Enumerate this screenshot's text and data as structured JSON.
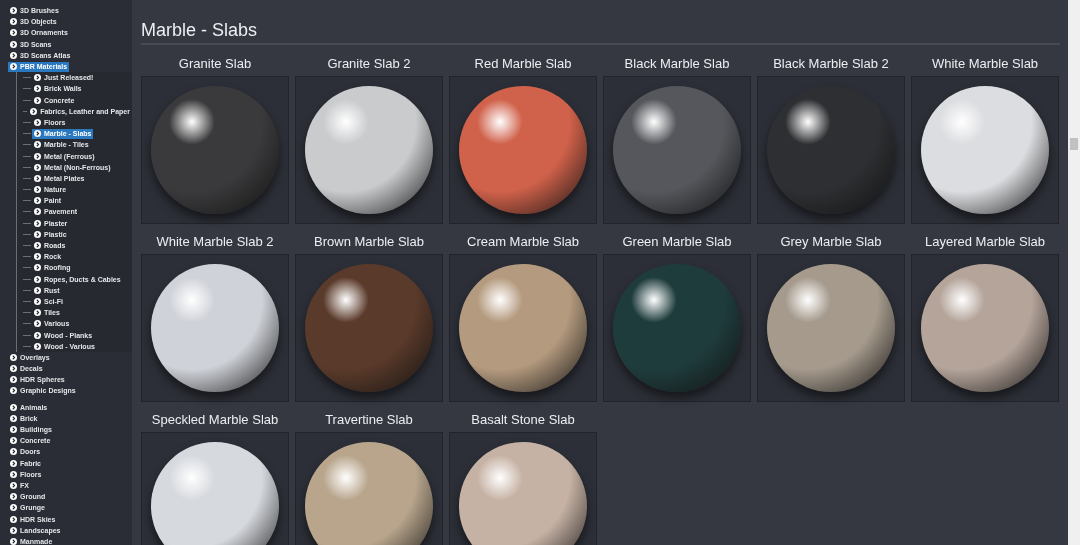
{
  "sidebar": {
    "groups": [
      {
        "items": [
          {
            "label": "3D Brushes",
            "selected": false
          },
          {
            "label": "3D Objects",
            "selected": false
          },
          {
            "label": "3D Ornaments",
            "selected": false
          },
          {
            "label": "3D Scans",
            "selected": false
          },
          {
            "label": "3D Scans Atlas",
            "selected": false
          },
          {
            "label": "PBR Materials",
            "selected": true,
            "children": [
              {
                "label": "Just Released!",
                "selected": false
              },
              {
                "label": "Brick Walls",
                "selected": false
              },
              {
                "label": "Concrete",
                "selected": false
              },
              {
                "label": "Fabrics, Leather and Paper",
                "selected": false
              },
              {
                "label": "Floors",
                "selected": false
              },
              {
                "label": "Marble - Slabs",
                "selected": true
              },
              {
                "label": "Marble - Tiles",
                "selected": false
              },
              {
                "label": "Metal (Ferrous)",
                "selected": false
              },
              {
                "label": "Metal (Non-Ferrous)",
                "selected": false
              },
              {
                "label": "Metal Plates",
                "selected": false
              },
              {
                "label": "Nature",
                "selected": false
              },
              {
                "label": "Paint",
                "selected": false
              },
              {
                "label": "Pavement",
                "selected": false
              },
              {
                "label": "Plaster",
                "selected": false
              },
              {
                "label": "Plastic",
                "selected": false
              },
              {
                "label": "Roads",
                "selected": false
              },
              {
                "label": "Rock",
                "selected": false
              },
              {
                "label": "Roofing",
                "selected": false
              },
              {
                "label": "Ropes, Ducts & Cables",
                "selected": false
              },
              {
                "label": "Rust",
                "selected": false
              },
              {
                "label": "Sci-Fi",
                "selected": false
              },
              {
                "label": "Tiles",
                "selected": false
              },
              {
                "label": "Various",
                "selected": false
              },
              {
                "label": "Wood - Planks",
                "selected": false
              },
              {
                "label": "Wood - Various",
                "selected": false
              }
            ]
          },
          {
            "label": "Overlays",
            "selected": false
          },
          {
            "label": "Decals",
            "selected": false
          },
          {
            "label": "HDR Spheres",
            "selected": false
          },
          {
            "label": "Graphic Designs",
            "selected": false
          }
        ]
      },
      {
        "items": [
          {
            "label": "Animals",
            "selected": false
          },
          {
            "label": "Brick",
            "selected": false
          },
          {
            "label": "Buildings",
            "selected": false
          },
          {
            "label": "Concrete",
            "selected": false
          },
          {
            "label": "Doors",
            "selected": false
          },
          {
            "label": "Fabric",
            "selected": false
          },
          {
            "label": "Floors",
            "selected": false
          },
          {
            "label": "FX",
            "selected": false
          },
          {
            "label": "Ground",
            "selected": false
          },
          {
            "label": "Grunge",
            "selected": false
          },
          {
            "label": "HDR Skies",
            "selected": false
          },
          {
            "label": "Landscapes",
            "selected": false
          },
          {
            "label": "Manmade",
            "selected": false
          }
        ]
      }
    ]
  },
  "page": {
    "title": "Marble - Slabs",
    "materials": [
      {
        "name": "Granite Slab",
        "color": "#3a3a3c"
      },
      {
        "name": "Granite Slab 2",
        "color": "#c9cbcd"
      },
      {
        "name": "Red Marble Slab",
        "color": "#d0614a"
      },
      {
        "name": "Black Marble Slab",
        "color": "#55575c"
      },
      {
        "name": "Black Marble Slab 2",
        "color": "#2e2f32"
      },
      {
        "name": "White Marble Slab",
        "color": "#dcdde0"
      },
      {
        "name": "White Marble Slab 2",
        "color": "#cfd2d8"
      },
      {
        "name": "Brown Marble Slab",
        "color": "#5a3a2a"
      },
      {
        "name": "Cream Marble Slab",
        "color": "#b49a7e"
      },
      {
        "name": "Green Marble Slab",
        "color": "#1f3c3d"
      },
      {
        "name": "Grey Marble Slab",
        "color": "#a59a8c"
      },
      {
        "name": "Layered Marble Slab",
        "color": "#b4a49a"
      },
      {
        "name": "Speckled Marble Slab",
        "color": "#d6d9de"
      },
      {
        "name": "Travertine Slab",
        "color": "#b8a58c"
      },
      {
        "name": "Basalt Stone Slab",
        "color": "#c6b2a4"
      }
    ]
  }
}
